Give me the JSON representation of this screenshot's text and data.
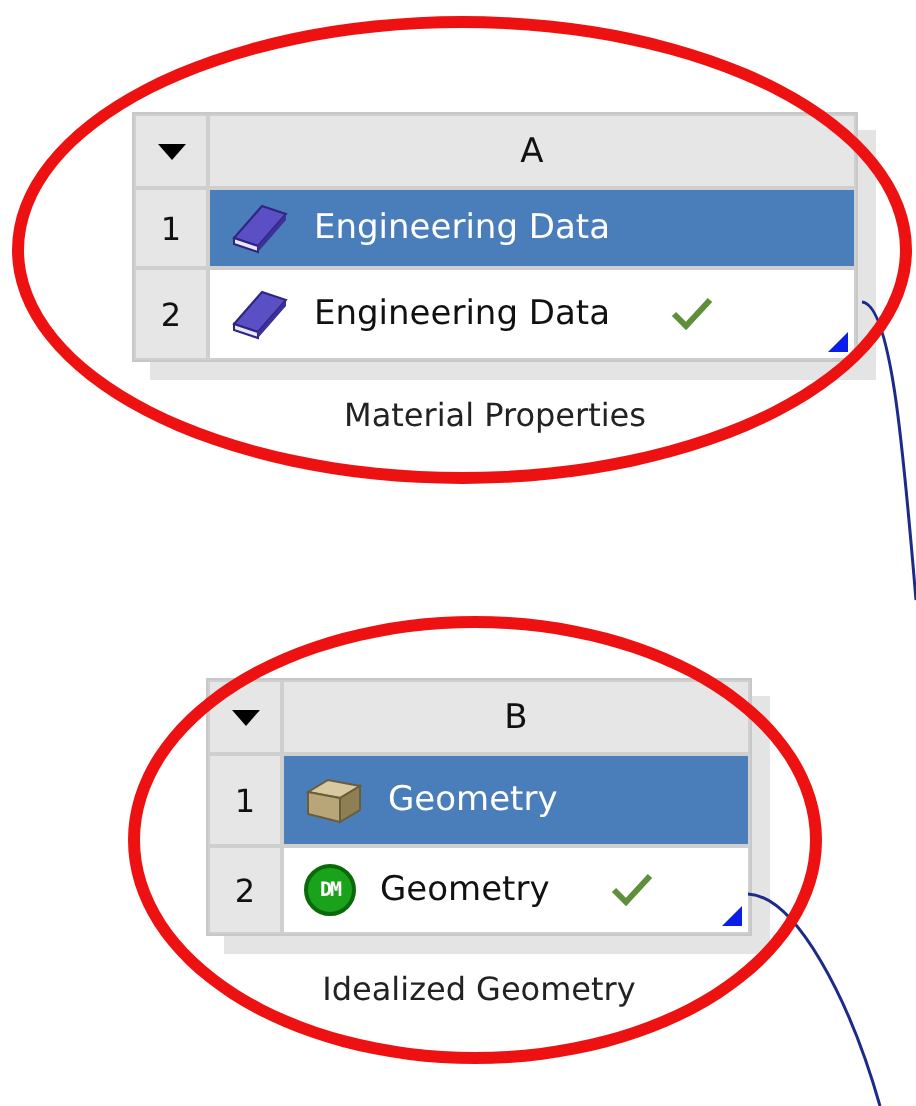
{
  "systems": [
    {
      "column": "A",
      "caption": "Material Properties",
      "rows": [
        {
          "number": "1",
          "label": "Engineering Data",
          "kind": "book",
          "selected": true,
          "up_to_date": false,
          "linked": false
        },
        {
          "number": "2",
          "label": "Engineering Data",
          "kind": "book",
          "selected": false,
          "up_to_date": true,
          "linked": true
        }
      ]
    },
    {
      "column": "B",
      "caption": "Idealized Geometry",
      "rows": [
        {
          "number": "1",
          "label": "Geometry",
          "kind": "solid",
          "selected": true,
          "up_to_date": false,
          "linked": false
        },
        {
          "number": "2",
          "label": "Geometry",
          "kind": "modeler",
          "badge": "DM",
          "selected": false,
          "up_to_date": true,
          "linked": true
        }
      ]
    }
  ]
}
